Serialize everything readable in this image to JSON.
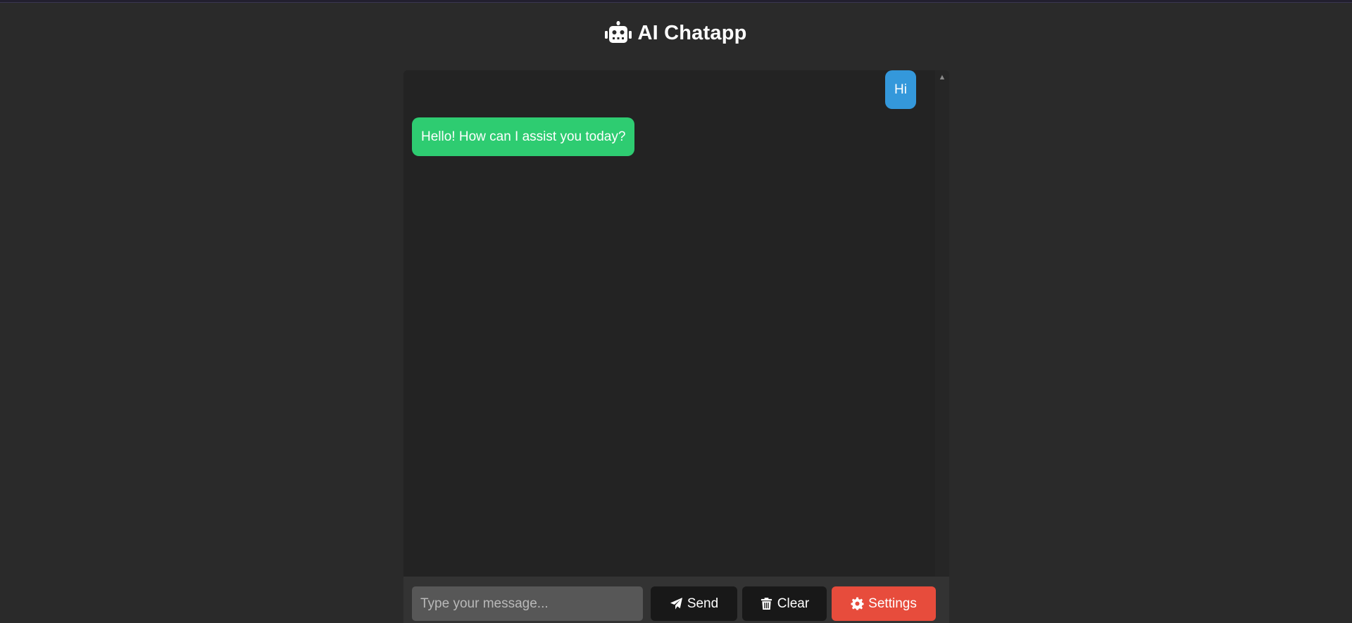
{
  "app": {
    "title": "AI Chatapp",
    "logo_icon": "robot-icon"
  },
  "messages": [
    {
      "role": "user",
      "text": "Hi",
      "color": "#3498db"
    },
    {
      "role": "bot",
      "text": "Hello! How can I assist you today?",
      "color": "#2ecc71"
    }
  ],
  "composer": {
    "placeholder": "Type your message...",
    "value": ""
  },
  "buttons": {
    "send": {
      "label": "Send",
      "icon": "paper-plane-icon"
    },
    "clear": {
      "label": "Clear",
      "icon": "trash-icon"
    },
    "settings": {
      "label": "Settings",
      "icon": "gear-icon",
      "color": "#e74c3c"
    }
  },
  "theme": {
    "background": "#2a2a2a",
    "chat_background": "#232323",
    "input_bar": "#333333"
  }
}
